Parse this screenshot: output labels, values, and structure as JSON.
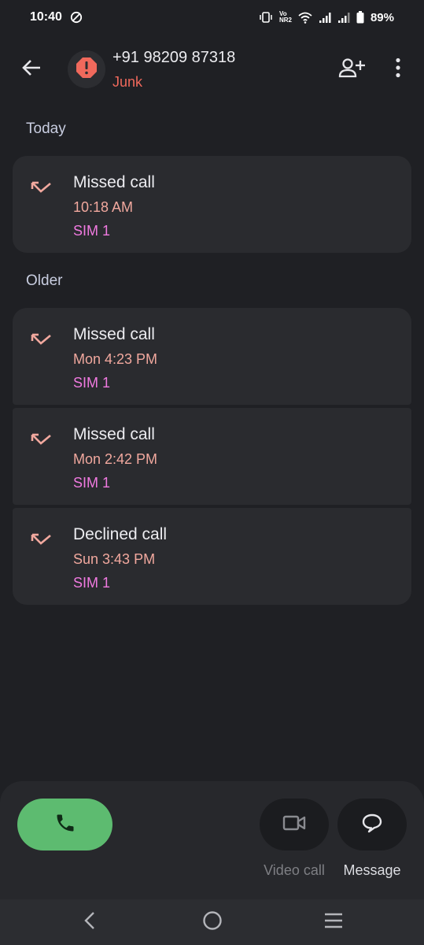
{
  "status_bar": {
    "time": "10:40",
    "battery": "89%",
    "network_label": "Vo NR2"
  },
  "contact": {
    "number": "+91 98209 87318",
    "tag": "Junk"
  },
  "sections": {
    "today": "Today",
    "older": "Older"
  },
  "calls": [
    {
      "type": "Missed call",
      "time": "10:18 AM",
      "sim": "SIM 1"
    },
    {
      "type": "Missed call",
      "time": "Mon 4:23 PM",
      "sim": "SIM 1"
    },
    {
      "type": "Missed call",
      "time": "Mon 2:42 PM",
      "sim": "SIM 1"
    },
    {
      "type": "Declined call",
      "time": "Sun 3:43 PM",
      "sim": "SIM 1"
    }
  ],
  "actions": {
    "video_call_label": "Video call",
    "message_label": "Message"
  },
  "icons": {
    "back": "arrow-left-icon",
    "avatar": "alert-icon",
    "add_contact": "person-add-icon",
    "more": "more-vert-icon",
    "missed": "call-missed-icon",
    "call": "phone-icon",
    "video": "videocam-icon",
    "message": "chat-bubble-icon"
  },
  "colors": {
    "background": "#1f2024",
    "card": "#2a2b2f",
    "junk_red": "#f0695c",
    "time_salmon": "#f1a89e",
    "sim_pink": "#f07ae0",
    "call_green": "#5dbb70"
  }
}
